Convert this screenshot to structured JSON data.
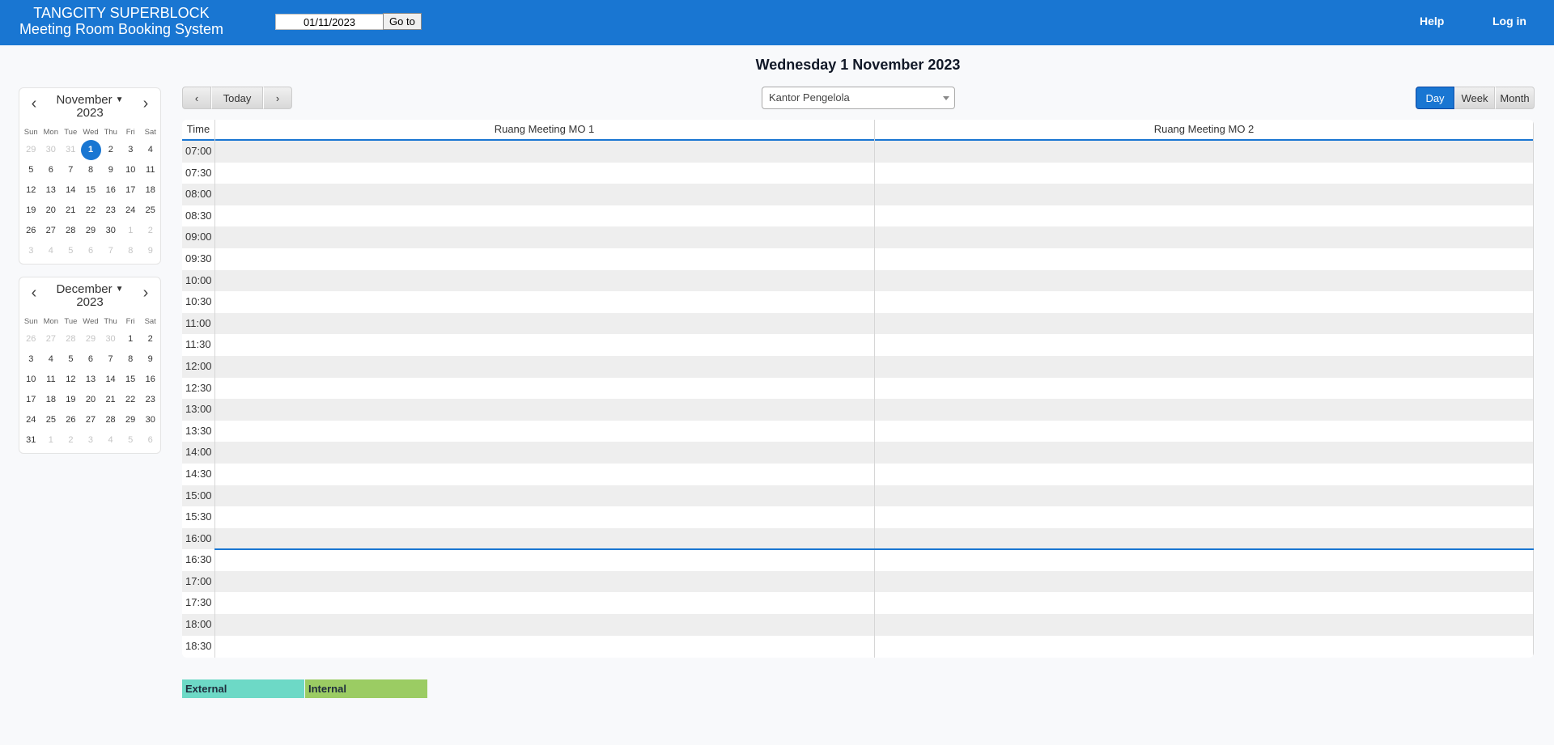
{
  "header": {
    "brand_line1": "TANGCITY SUPERBLOCK",
    "brand_line2": "Meeting Room Booking System",
    "goto_date_value": "01/11/2023",
    "goto_button": "Go to",
    "help_link": "Help",
    "login_link": "Log in",
    "color": "#1976d2"
  },
  "minicals": [
    {
      "month": "November",
      "year": "2023",
      "dow": [
        "Sun",
        "Mon",
        "Tue",
        "Wed",
        "Thu",
        "Fri",
        "Sat"
      ],
      "days": [
        {
          "d": "29",
          "m": true
        },
        {
          "d": "30",
          "m": true
        },
        {
          "d": "31",
          "m": true
        },
        {
          "d": "1",
          "sel": true
        },
        {
          "d": "2"
        },
        {
          "d": "3"
        },
        {
          "d": "4"
        },
        {
          "d": "5"
        },
        {
          "d": "6"
        },
        {
          "d": "7"
        },
        {
          "d": "8"
        },
        {
          "d": "9"
        },
        {
          "d": "10"
        },
        {
          "d": "11"
        },
        {
          "d": "12"
        },
        {
          "d": "13"
        },
        {
          "d": "14"
        },
        {
          "d": "15"
        },
        {
          "d": "16"
        },
        {
          "d": "17"
        },
        {
          "d": "18"
        },
        {
          "d": "19"
        },
        {
          "d": "20"
        },
        {
          "d": "21"
        },
        {
          "d": "22"
        },
        {
          "d": "23"
        },
        {
          "d": "24"
        },
        {
          "d": "25"
        },
        {
          "d": "26"
        },
        {
          "d": "27"
        },
        {
          "d": "28"
        },
        {
          "d": "29"
        },
        {
          "d": "30"
        },
        {
          "d": "1",
          "m": true
        },
        {
          "d": "2",
          "m": true
        },
        {
          "d": "3",
          "m": true
        },
        {
          "d": "4",
          "m": true
        },
        {
          "d": "5",
          "m": true
        },
        {
          "d": "6",
          "m": true
        },
        {
          "d": "7",
          "m": true
        },
        {
          "d": "8",
          "m": true
        },
        {
          "d": "9",
          "m": true
        }
      ]
    },
    {
      "month": "December",
      "year": "2023",
      "dow": [
        "Sun",
        "Mon",
        "Tue",
        "Wed",
        "Thu",
        "Fri",
        "Sat"
      ],
      "days": [
        {
          "d": "26",
          "m": true
        },
        {
          "d": "27",
          "m": true
        },
        {
          "d": "28",
          "m": true
        },
        {
          "d": "29",
          "m": true
        },
        {
          "d": "30",
          "m": true
        },
        {
          "d": "1"
        },
        {
          "d": "2"
        },
        {
          "d": "3"
        },
        {
          "d": "4"
        },
        {
          "d": "5"
        },
        {
          "d": "6"
        },
        {
          "d": "7"
        },
        {
          "d": "8"
        },
        {
          "d": "9"
        },
        {
          "d": "10"
        },
        {
          "d": "11"
        },
        {
          "d": "12"
        },
        {
          "d": "13"
        },
        {
          "d": "14"
        },
        {
          "d": "15"
        },
        {
          "d": "16"
        },
        {
          "d": "17"
        },
        {
          "d": "18"
        },
        {
          "d": "19"
        },
        {
          "d": "20"
        },
        {
          "d": "21"
        },
        {
          "d": "22"
        },
        {
          "d": "23"
        },
        {
          "d": "24"
        },
        {
          "d": "25"
        },
        {
          "d": "26"
        },
        {
          "d": "27"
        },
        {
          "d": "28"
        },
        {
          "d": "29"
        },
        {
          "d": "30"
        },
        {
          "d": "31"
        },
        {
          "d": "1",
          "m": true
        },
        {
          "d": "2",
          "m": true
        },
        {
          "d": "3",
          "m": true
        },
        {
          "d": "4",
          "m": true
        },
        {
          "d": "5",
          "m": true
        },
        {
          "d": "6",
          "m": true
        }
      ]
    }
  ],
  "main": {
    "title": "Wednesday 1 November 2023",
    "nav": {
      "prev": "‹",
      "today": "Today",
      "next": "›"
    },
    "area_select": "Kantor Pengelola",
    "views": [
      {
        "label": "Day",
        "active": true
      },
      {
        "label": "Week",
        "active": false
      },
      {
        "label": "Month",
        "active": false
      }
    ],
    "grid": {
      "time_header": "Time",
      "rooms": [
        "Ruang Meeting MO 1",
        "Ruang Meeting MO 2"
      ],
      "times": [
        "07:00",
        "07:30",
        "08:00",
        "08:30",
        "09:00",
        "09:30",
        "10:00",
        "10:30",
        "11:00",
        "11:30",
        "12:00",
        "12:30",
        "13:00",
        "13:30",
        "14:00",
        "14:30",
        "15:00",
        "15:30",
        "16:00",
        "16:30",
        "17:00",
        "17:30",
        "18:00",
        "18:30"
      ],
      "current_time_marker": "16:30"
    }
  },
  "legend": [
    {
      "label": "External",
      "color": "#6dd9c6"
    },
    {
      "label": "Internal",
      "color": "#9bcc63"
    }
  ]
}
